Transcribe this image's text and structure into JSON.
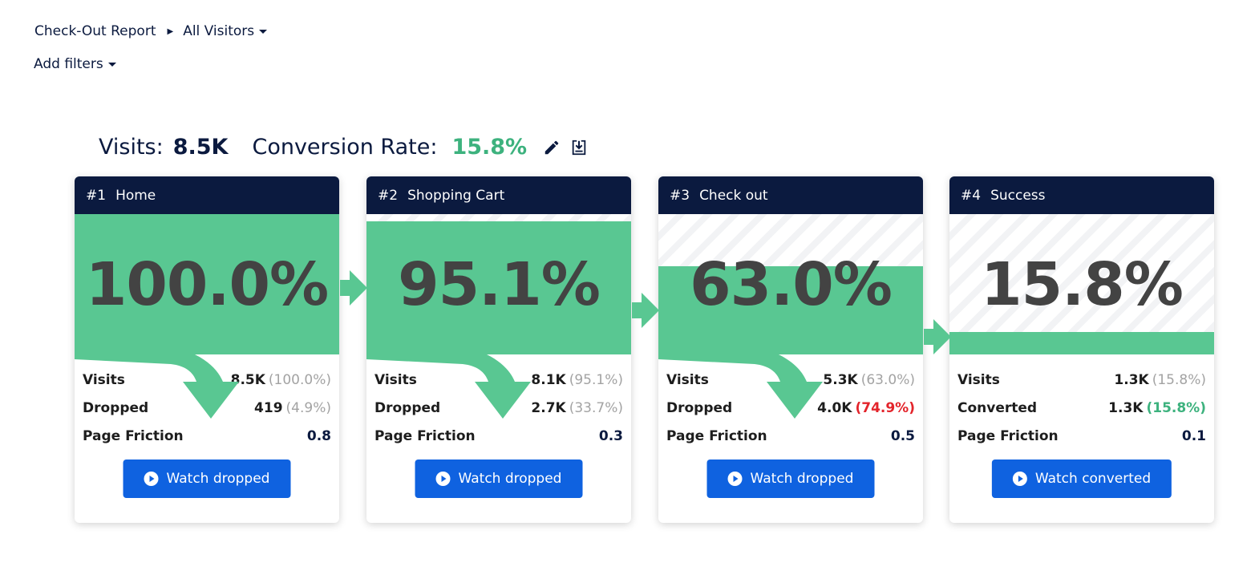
{
  "breadcrumb": {
    "report": "Check-Out Report",
    "segment": "All Visitors"
  },
  "filters": {
    "label": "Add filters"
  },
  "summary": {
    "visits_label": "Visits:",
    "visits_value": "8.5K",
    "conversion_label": "Conversion Rate:",
    "conversion_value": "15.8%",
    "icons": [
      "pencil-icon",
      "download-icon"
    ]
  },
  "colors": {
    "header_bg": "#0b1a3f",
    "funnel_green": "#59c792",
    "conversion_green": "#3db27e",
    "button_blue": "#0f62e0",
    "drop_red": "#e3242b"
  },
  "steps": [
    {
      "num": "#1",
      "name": "Home",
      "percent": "100.0%",
      "fill_fraction": 1.0,
      "rows": [
        {
          "label": "Visits",
          "value": "8.5K",
          "pct": "(100.0%)"
        },
        {
          "label": "Dropped",
          "value": "419",
          "pct": "(4.9%)"
        },
        {
          "label": "Page Friction",
          "value": "0.8",
          "pct": ""
        }
      ],
      "button": "Watch dropped"
    },
    {
      "num": "#2",
      "name": "Shopping Cart",
      "percent": "95.1%",
      "fill_fraction": 0.951,
      "rows": [
        {
          "label": "Visits",
          "value": "8.1K",
          "pct": "(95.1%)"
        },
        {
          "label": "Dropped",
          "value": "2.7K",
          "pct": "(33.7%)"
        },
        {
          "label": "Page Friction",
          "value": "0.3",
          "pct": ""
        }
      ],
      "button": "Watch dropped"
    },
    {
      "num": "#3",
      "name": "Check out",
      "percent": "63.0%",
      "fill_fraction": 0.63,
      "rows": [
        {
          "label": "Visits",
          "value": "5.3K",
          "pct": "(63.0%)"
        },
        {
          "label": "Dropped",
          "value": "4.0K",
          "pct": "(74.9%)"
        },
        {
          "label": "Page Friction",
          "value": "0.5",
          "pct": ""
        }
      ],
      "button": "Watch dropped"
    },
    {
      "num": "#4",
      "name": "Success",
      "percent": "15.8%",
      "fill_fraction": 0.158,
      "rows": [
        {
          "label": "Visits",
          "value": "1.3K",
          "pct": "(15.8%)"
        },
        {
          "label": "Converted",
          "value": "1.3K",
          "pct": "(15.8%)"
        },
        {
          "label": "Page Friction",
          "value": "0.1",
          "pct": ""
        }
      ],
      "button": "Watch converted"
    }
  ]
}
